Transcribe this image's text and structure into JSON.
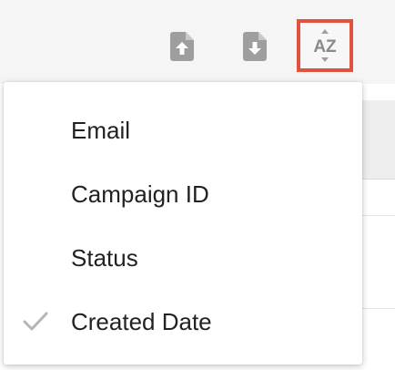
{
  "toolbar": {
    "upload_icon": "file-upload-icon",
    "download_icon": "file-download-icon",
    "sort_icon": "sort-az-icon",
    "sort_label": "AZ",
    "highlight_color": "#e0533d",
    "icon_color": "#9e9e9e"
  },
  "sort_menu": {
    "items": [
      {
        "label": "Email",
        "selected": false
      },
      {
        "label": "Campaign ID",
        "selected": false
      },
      {
        "label": "Status",
        "selected": false
      },
      {
        "label": "Created Date",
        "selected": true
      }
    ],
    "check_icon": "checkmark-icon"
  }
}
